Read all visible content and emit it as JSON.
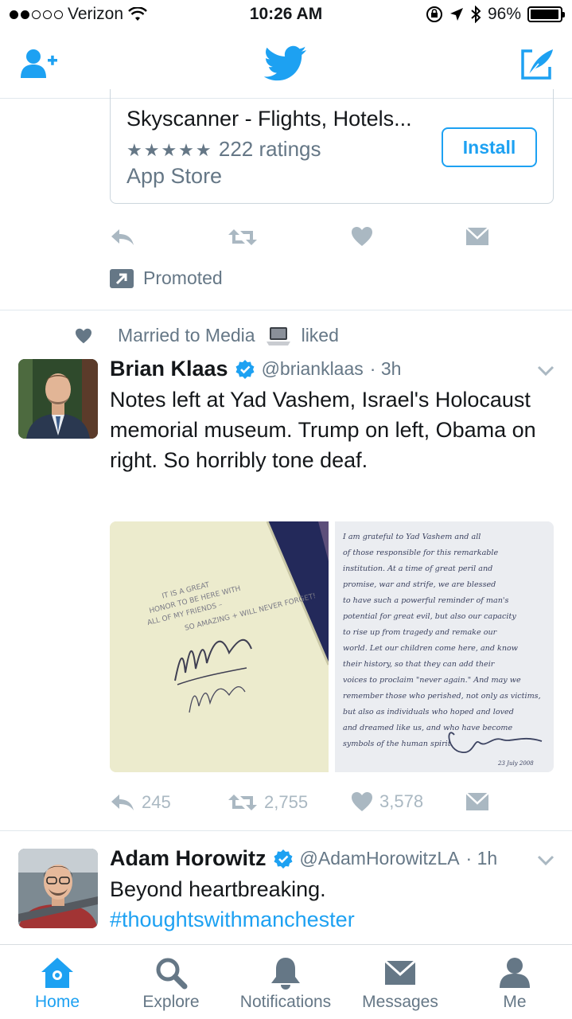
{
  "status_bar": {
    "carrier": "Verizon",
    "time": "10:26 AM",
    "battery": "96%",
    "signal_dots_filled": 2,
    "signal_dots_total": 5
  },
  "header": {
    "add_user_icon": "add-user-icon",
    "logo_icon": "twitter-bird-icon",
    "compose_icon": "compose-tweet-icon"
  },
  "ad": {
    "title": "Skyscanner - Flights, Hotels...",
    "stars": "★★★★★",
    "ratings": "222 ratings",
    "store": "App Store",
    "install_label": "Install"
  },
  "promoted_label": "Promoted",
  "tweets": [
    {
      "social_context": "Married to Media",
      "social_action": "liked",
      "name": "Brian Klaas",
      "handle": "@brianklaas",
      "time": "· 3h",
      "text": "Notes left at Yad Vashem, Israel's Holocaust memorial museum. Trump on left, Obama on right. So horribly tone deaf.",
      "replies": "245",
      "retweets": "2,755",
      "likes": "3,578",
      "note_left": "It is a great honor to be here with all of my friends – so amazing + will never forget!",
      "note_right": "I am grateful to Yad Vashem and all of those responsible for this remarkable institution. At a time of great peril and promise, war and strife, we are blessed to have such a powerful reminder of man's potential for great evil, but also our capacity to rise up from tragedy and remake our world. Let our children come here, and know their history, so that they can add their voices to proclaim \"never again.\" And may we remember those who perished, not only as victims, but also as individuals who hoped and loved and dreamed like us, and who have become symbols of the human spirit.",
      "note_right_date": "23 July 2008"
    },
    {
      "name": "Adam Horowitz",
      "handle": "@AdamHorowitzLA",
      "time": "· 1h",
      "text_line1": "Beyond heartbreaking.",
      "hashtag": "#thoughtswithmanchester"
    }
  ],
  "tabs": [
    {
      "label": "Home",
      "icon": "home-icon",
      "active": true
    },
    {
      "label": "Explore",
      "icon": "search-icon",
      "active": false
    },
    {
      "label": "Notifications",
      "icon": "bell-icon",
      "active": false
    },
    {
      "label": "Messages",
      "icon": "envelope-icon",
      "active": false
    },
    {
      "label": "Me",
      "icon": "profile-icon",
      "active": false
    }
  ],
  "colors": {
    "accent": "#1da1f2",
    "secondary_text": "#657786",
    "action_icon": "#aab8c2",
    "border": "#e1e8ed"
  }
}
